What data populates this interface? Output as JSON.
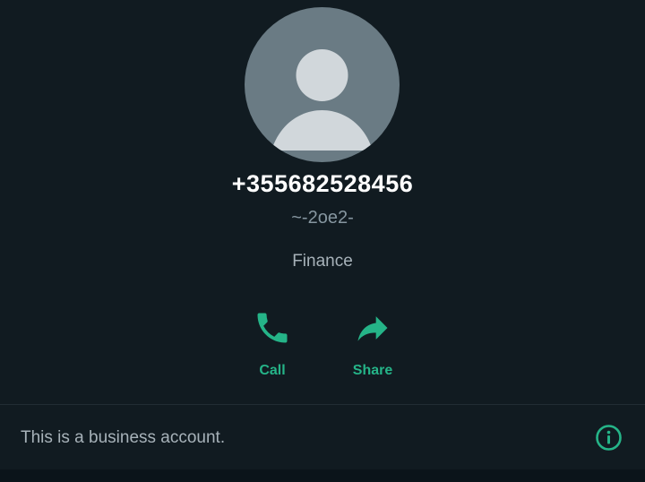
{
  "contact": {
    "phone": "+355682528456",
    "nickname": "~-2oe2-",
    "category": "Finance",
    "avatar_icon": "default-person-avatar"
  },
  "actions": [
    {
      "label": "Call",
      "icon": "phone-icon"
    },
    {
      "label": "Share",
      "icon": "share-arrow-icon"
    }
  ],
  "business": {
    "text": "This is a business account.",
    "icon": "info-icon"
  },
  "colors": {
    "background": "#111b21",
    "accent": "#25b488",
    "primary_text": "#ffffff",
    "secondary_text": "#8696a0",
    "avatar_bg": "#6a7b84",
    "avatar_fg": "#d1d7db"
  }
}
